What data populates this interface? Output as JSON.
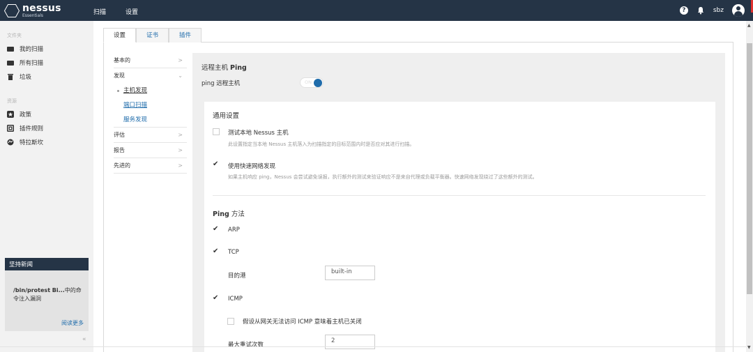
{
  "brand": {
    "name": "nessus",
    "edition": "Essentials"
  },
  "topnav": {
    "scan": "扫描",
    "settings": "设置",
    "user": "sbz"
  },
  "sidebar": {
    "folders_heading": "文件夹",
    "folders": [
      "我的扫描",
      "所有扫描",
      "垃圾"
    ],
    "resources_heading": "资源",
    "resources": [
      "政策",
      "插件规则",
      "特拉斯坎"
    ],
    "news": {
      "heading": "坚持新闻",
      "title_bold": "/bin/protest Bi...",
      "title_rest": "中的命令注入漏洞",
      "more": "阅读更多"
    },
    "collapse": "«"
  },
  "tabs": [
    "设置",
    "证书",
    "插件"
  ],
  "settings_nav": {
    "basic": "基本的",
    "discovery": "发现",
    "discovery_items": [
      "主机发现",
      "端口扫描",
      "服务发现"
    ],
    "assessment": "评估",
    "report": "报告",
    "advanced": "先进的"
  },
  "panel": {
    "title_prefix": "远程主机 ",
    "title_bold": "Ping",
    "ping_label": "ping 远程主机",
    "toggle_text": "ON",
    "general_heading": "通用设置",
    "opt1": {
      "label": "测试本地 Nessus 主机",
      "desc": "此设置指定当本地 Nessus 主机落入为扫描指定的目标范围内时是否应对其进行扫描。",
      "checked": false
    },
    "opt2": {
      "label": "使用快速网络发现",
      "desc": "如果主机响应 ping，Nessus 会尝试避免误报，执行额外的测试来验证响应不是来自代理或负载平衡器。快速网络发现绕过了这些额外的测试。",
      "checked": true
    },
    "ping_methods_bold": "Ping",
    "ping_methods_rest": " 方法",
    "arp": "ARP",
    "tcp": "TCP",
    "dest_port_label": "目的港",
    "dest_port_value": "built-in",
    "icmp": "ICMP",
    "icmp_opt": "假设从网关无法访问 ICMP 意味着主机已关闭",
    "max_retries_label": "最大重试次数",
    "max_retries_value": "2"
  }
}
